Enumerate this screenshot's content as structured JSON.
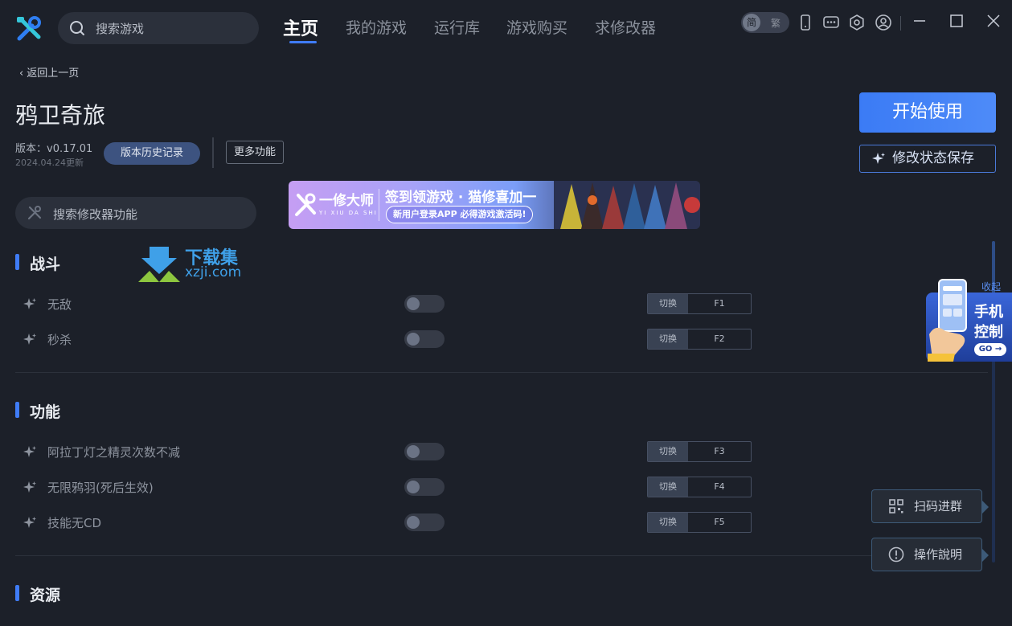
{
  "titlebar": {
    "search_placeholder": "搜索游戏",
    "nav": [
      "主页",
      "我的游戏",
      "运行库",
      "游戏购买",
      "求修改器"
    ],
    "active_nav": "主页",
    "lang_on": "简",
    "lang_off": "繁",
    "icons": [
      "phone-icon",
      "chat-icon",
      "settings-icon",
      "user-icon"
    ],
    "window_controls": [
      "minimize-icon",
      "maximize-icon",
      "close-icon"
    ]
  },
  "back_label": "返回上一页",
  "game": {
    "title": "鸦卫奇旅",
    "version": "版本：v0.17.01",
    "update_date": "2024.04.24更新",
    "history_button": "版本历史记录",
    "more_button": "更多功能"
  },
  "actions": {
    "start_button": "开始使用",
    "save_state_button": "修改状态保存"
  },
  "banner": {
    "brand": "一修大师",
    "brand_sub": "YI XIU DA SHI",
    "headline": "签到领游戏 · 猫修喜加一",
    "pill": "新用户登录APP 必得游戏激活码!"
  },
  "mod_search_placeholder": "搜索修改器功能",
  "watermark": {
    "name": "下载集",
    "url": "xzji.com"
  },
  "sections": [
    {
      "title": "战斗",
      "features": [
        {
          "label": "无敌",
          "switch_label": "切换",
          "hotkey": "F1",
          "enabled": false
        },
        {
          "label": "秒杀",
          "switch_label": "切换",
          "hotkey": "F2",
          "enabled": false
        }
      ]
    },
    {
      "title": "功能",
      "features": [
        {
          "label": "阿拉丁灯之精灵次数不减",
          "switch_label": "切换",
          "hotkey": "F3",
          "enabled": false
        },
        {
          "label": "无限鸦羽(死后生效)",
          "switch_label": "切换",
          "hotkey": "F4",
          "enabled": false
        },
        {
          "label": "技能无CD",
          "switch_label": "切换",
          "hotkey": "F5",
          "enabled": false
        }
      ]
    },
    {
      "title": "资源",
      "features": []
    }
  ],
  "phone_promo": {
    "collapse": "收起",
    "line1": "手机",
    "line2": "控制",
    "go": "GO →"
  },
  "floating": {
    "qr_group": "扫码进群",
    "instructions": "操作說明"
  },
  "colors": {
    "background": "#1c2029",
    "accent": "#3f7cf7",
    "panel": "#2b303b"
  }
}
